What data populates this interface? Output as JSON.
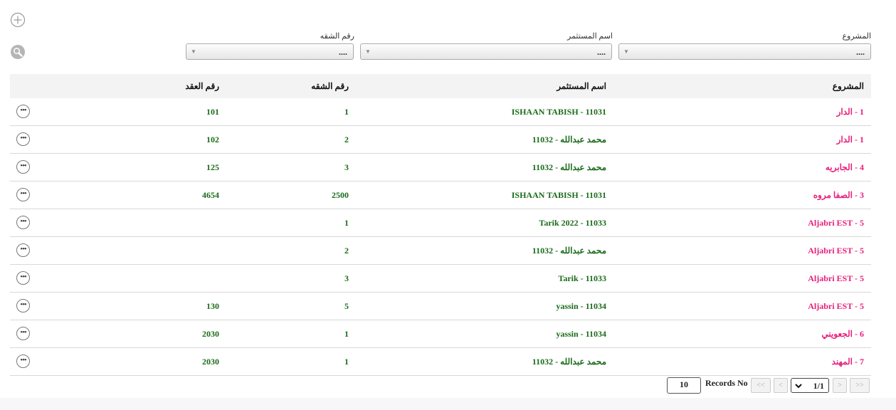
{
  "filters": {
    "project": {
      "label": "المشروع",
      "value": "...."
    },
    "investor": {
      "label": "اسم المستثمر",
      "value": "...."
    },
    "apartment": {
      "label": "رقم الشقه",
      "value": "...."
    }
  },
  "icons": {
    "add": "plus-circle-icon",
    "search": "magnifier-icon",
    "more": "ellipsis-circle-icon"
  },
  "table": {
    "headers": {
      "project": "المشروع",
      "investor": "اسم المستثمر",
      "apartment": "رقم الشقه",
      "contract": "رقم العقد"
    },
    "rows": [
      {
        "project": "1 - الدار",
        "investor": "ISHAAN TABISH - 11031",
        "apartment": "1",
        "contract": "101"
      },
      {
        "project": "1 - الدار",
        "investor": "11032 - محمد عبدالله",
        "apartment": "2",
        "contract": "102"
      },
      {
        "project": "4 - الجابريه",
        "investor": "11032 - محمد عبدالله",
        "apartment": "3",
        "contract": "125"
      },
      {
        "project": "3 - الصفا مروه",
        "investor": "ISHAAN TABISH - 11031",
        "apartment": "2500",
        "contract": "4654"
      },
      {
        "project": "Aljabri EST - 5",
        "investor": "Tarik 2022 - 11033",
        "apartment": "1",
        "contract": ""
      },
      {
        "project": "Aljabri EST - 5",
        "investor": "11032 - محمد عبدالله",
        "apartment": "2",
        "contract": ""
      },
      {
        "project": "Aljabri EST - 5",
        "investor": "Tarik - 11033",
        "apartment": "3",
        "contract": ""
      },
      {
        "project": "Aljabri EST - 5",
        "investor": "yassin - 11034",
        "apartment": "5",
        "contract": "130"
      },
      {
        "project": "6 - الجعويني",
        "investor": "yassin - 11034",
        "apartment": "1",
        "contract": "2030"
      },
      {
        "project": "7 - المهند",
        "investor": "11032 - محمد عبدالله",
        "apartment": "1",
        "contract": "2030"
      }
    ]
  },
  "pagination": {
    "records_value": "10",
    "records_label": "Records No",
    "first": "<<",
    "prev": "<",
    "page": "1/1",
    "next": ">",
    "last": ">>"
  },
  "colors": {
    "project_text": "#e8207a",
    "value_text": "#1a6b1a",
    "header_bg": "#f3f3f3"
  }
}
